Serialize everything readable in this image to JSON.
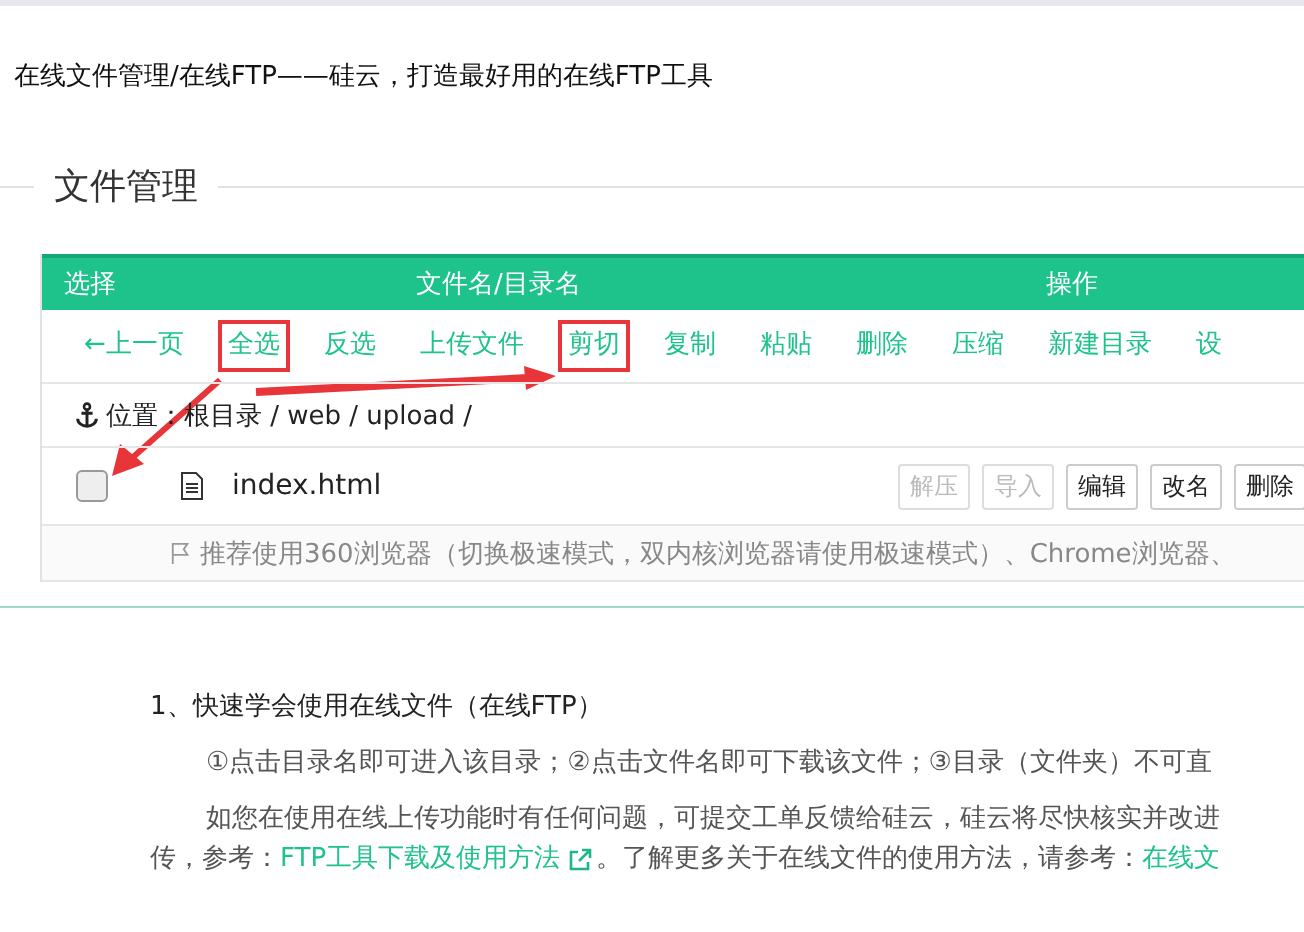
{
  "page_title": "在线文件管理/在线FTP——硅云，打造最好用的在线FTP工具",
  "section_title": "文件管理",
  "table": {
    "columns": [
      "选择",
      "文件名/目录名",
      "操作"
    ],
    "toolbar": [
      {
        "label": "←上一页",
        "annotated": false
      },
      {
        "label": "全选",
        "annotated": true
      },
      {
        "label": "反选",
        "annotated": false
      },
      {
        "label": "上传文件",
        "annotated": false
      },
      {
        "label": "剪切",
        "annotated": true
      },
      {
        "label": "复制",
        "annotated": false
      },
      {
        "label": "粘贴",
        "annotated": false
      },
      {
        "label": "删除",
        "annotated": false
      },
      {
        "label": "压缩",
        "annotated": false
      },
      {
        "label": "新建目录",
        "annotated": false
      },
      {
        "label": "设",
        "annotated": false
      }
    ],
    "path": "位置：根目录 / web / upload /",
    "rows": [
      {
        "name": "index.html",
        "checked": false,
        "actions": [
          {
            "label": "解压",
            "disabled": true
          },
          {
            "label": "导入",
            "disabled": true
          },
          {
            "label": "编辑",
            "disabled": false
          },
          {
            "label": "改名",
            "disabled": false
          },
          {
            "label": "删除",
            "disabled": false
          }
        ]
      }
    ],
    "notice": "推荐使用360浏览器（切换极速模式，双内核浏览器请使用极速模式）、Chrome浏览器、"
  },
  "help": {
    "heading": "1、快速学会使用在线文件（在线FTP）",
    "tip": "①点击目录名即可进入该目录；②点击文件名即可下载该文件；③目录（文件夹）不可直",
    "para_line1": "如您在使用在线上传功能时有任何问题，可提交工单反馈给硅云，硅云将尽快核实并改进",
    "para_line2_prefix": "传，参考：",
    "link1": "FTP工具下载及使用方法",
    "para_line2_middle": "。了解更多关于在线文件的使用方法，请参考：",
    "link2": "在线文"
  }
}
